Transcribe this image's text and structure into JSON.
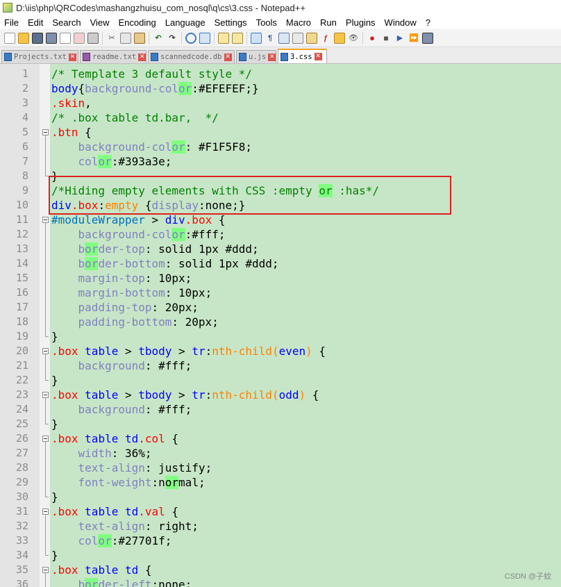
{
  "window": {
    "title": "D:\\iis\\php\\QRCodes\\mashangzhuisu_com_nosql\\q\\cs\\3.css - Notepad++"
  },
  "menu": [
    "File",
    "Edit",
    "Search",
    "View",
    "Encoding",
    "Language",
    "Settings",
    "Tools",
    "Macro",
    "Run",
    "Plugins",
    "Window",
    "?"
  ],
  "tabs": [
    {
      "label": "Projects.txt",
      "icon": "file-blue-icon",
      "active": false
    },
    {
      "label": "readme.txt",
      "icon": "file-purple-icon",
      "active": false
    },
    {
      "label": "scannedcode.db",
      "icon": "file-blue-icon",
      "active": false
    },
    {
      "label": "u.js",
      "icon": "file-blue-icon",
      "active": false
    },
    {
      "label": "3.css",
      "icon": "file-blue-icon",
      "active": true
    }
  ],
  "editor": {
    "lines": [
      {
        "n": "1",
        "tokens": [
          [
            "com",
            "/* Template 3 default style */"
          ]
        ]
      },
      {
        "n": "2",
        "tokens": [
          [
            "sel",
            "body"
          ],
          [
            "pun",
            "{"
          ],
          [
            "prop",
            "background-col"
          ],
          [
            "prop hl",
            "or"
          ],
          [
            "pun",
            ":"
          ],
          [
            "val",
            "#EFEFEF"
          ],
          [
            "pun",
            ";}"
          ]
        ]
      },
      {
        "n": "3",
        "tokens": [
          [
            "cls",
            ".skin"
          ],
          [
            "pun",
            ","
          ]
        ]
      },
      {
        "n": "4",
        "tokens": [
          [
            "com",
            "/* .box table td.bar,  */"
          ]
        ]
      },
      {
        "n": "5",
        "tokens": [
          [
            "cls",
            ".btn"
          ],
          [
            "pun",
            " {"
          ]
        ]
      },
      {
        "n": "6",
        "tokens": [
          [
            "pun",
            "    "
          ],
          [
            "prop",
            "background-col"
          ],
          [
            "prop hl",
            "or"
          ],
          [
            "pun",
            ": "
          ],
          [
            "val",
            "#F1F5F8"
          ],
          [
            "pun",
            ";"
          ]
        ]
      },
      {
        "n": "7",
        "tokens": [
          [
            "pun",
            "    "
          ],
          [
            "prop",
            "col"
          ],
          [
            "prop hl",
            "or"
          ],
          [
            "pun",
            ":"
          ],
          [
            "val",
            "#393a3e"
          ],
          [
            "pun",
            ";"
          ]
        ]
      },
      {
        "n": "8",
        "tokens": [
          [
            "pun",
            "}"
          ]
        ]
      },
      {
        "n": "9",
        "tokens": [
          [
            "com",
            "/*Hiding empty elements with CSS :empty "
          ],
          [
            "com hl",
            "or"
          ],
          [
            "com",
            " :has*/"
          ]
        ]
      },
      {
        "n": "10",
        "tokens": [
          [
            "sel",
            "div"
          ],
          [
            "cls",
            ".box"
          ],
          [
            "pun",
            ":"
          ],
          [
            "pse",
            "empty"
          ],
          [
            "pun",
            " {"
          ],
          [
            "prop",
            "display"
          ],
          [
            "pun",
            ":"
          ],
          [
            "val",
            "none"
          ],
          [
            "pun",
            ";}"
          ]
        ]
      },
      {
        "n": "11",
        "tokens": [
          [
            "id",
            "#moduleWrapper"
          ],
          [
            "pun",
            " > "
          ],
          [
            "sel",
            "div"
          ],
          [
            "cls",
            ".box"
          ],
          [
            "pun",
            " {"
          ]
        ]
      },
      {
        "n": "12",
        "tokens": [
          [
            "pun",
            "    "
          ],
          [
            "prop",
            "background-col"
          ],
          [
            "prop hl",
            "or"
          ],
          [
            "pun",
            ":"
          ],
          [
            "val",
            "#fff"
          ],
          [
            "pun",
            ";"
          ]
        ]
      },
      {
        "n": "13",
        "tokens": [
          [
            "pun",
            "    "
          ],
          [
            "prop",
            "b"
          ],
          [
            "prop hl",
            "or"
          ],
          [
            "prop",
            "der-top"
          ],
          [
            "pun",
            ": "
          ],
          [
            "val",
            "solid 1px #ddd"
          ],
          [
            "pun",
            ";"
          ]
        ]
      },
      {
        "n": "14",
        "tokens": [
          [
            "pun",
            "    "
          ],
          [
            "prop",
            "b"
          ],
          [
            "prop hl",
            "or"
          ],
          [
            "prop",
            "der-bottom"
          ],
          [
            "pun",
            ": "
          ],
          [
            "val",
            "solid 1px #ddd"
          ],
          [
            "pun",
            ";"
          ]
        ]
      },
      {
        "n": "15",
        "tokens": [
          [
            "pun",
            "    "
          ],
          [
            "prop",
            "margin-top"
          ],
          [
            "pun",
            ": "
          ],
          [
            "val",
            "10px"
          ],
          [
            "pun",
            ";"
          ]
        ]
      },
      {
        "n": "16",
        "tokens": [
          [
            "pun",
            "    "
          ],
          [
            "prop",
            "margin-bottom"
          ],
          [
            "pun",
            ": "
          ],
          [
            "val",
            "10px"
          ],
          [
            "pun",
            ";"
          ]
        ]
      },
      {
        "n": "17",
        "tokens": [
          [
            "pun",
            "    "
          ],
          [
            "prop",
            "padding-top"
          ],
          [
            "pun",
            ": "
          ],
          [
            "val",
            "20px"
          ],
          [
            "pun",
            ";"
          ]
        ]
      },
      {
        "n": "18",
        "tokens": [
          [
            "pun",
            "    "
          ],
          [
            "prop",
            "padding-bottom"
          ],
          [
            "pun",
            ": "
          ],
          [
            "val",
            "20px"
          ],
          [
            "pun",
            ";"
          ]
        ]
      },
      {
        "n": "19",
        "tokens": [
          [
            "pun",
            "}"
          ]
        ]
      },
      {
        "n": "20",
        "tokens": [
          [
            "cls",
            ".box"
          ],
          [
            "pun",
            " "
          ],
          [
            "sel",
            "table"
          ],
          [
            "pun",
            " > "
          ],
          [
            "sel",
            "tbody"
          ],
          [
            "pun",
            " > "
          ],
          [
            "sel",
            "tr"
          ],
          [
            "pun",
            ":"
          ],
          [
            "pse",
            "nth-child"
          ],
          [
            "pse",
            "("
          ],
          [
            "arg",
            "even"
          ],
          [
            "pse",
            ")"
          ],
          [
            "pun",
            " {"
          ]
        ]
      },
      {
        "n": "21",
        "tokens": [
          [
            "pun",
            "    "
          ],
          [
            "prop",
            "background"
          ],
          [
            "pun",
            ": "
          ],
          [
            "val",
            "#fff"
          ],
          [
            "pun",
            ";"
          ]
        ]
      },
      {
        "n": "22",
        "tokens": [
          [
            "pun",
            "}"
          ]
        ]
      },
      {
        "n": "23",
        "tokens": [
          [
            "cls",
            ".box"
          ],
          [
            "pun",
            " "
          ],
          [
            "sel",
            "table"
          ],
          [
            "pun",
            " > "
          ],
          [
            "sel",
            "tbody"
          ],
          [
            "pun",
            " > "
          ],
          [
            "sel",
            "tr"
          ],
          [
            "pun",
            ":"
          ],
          [
            "pse",
            "nth-child"
          ],
          [
            "pse",
            "("
          ],
          [
            "arg",
            "odd"
          ],
          [
            "pse",
            ")"
          ],
          [
            "pun",
            " {"
          ]
        ]
      },
      {
        "n": "24",
        "tokens": [
          [
            "pun",
            "    "
          ],
          [
            "prop",
            "background"
          ],
          [
            "pun",
            ": "
          ],
          [
            "val",
            "#fff"
          ],
          [
            "pun",
            ";"
          ]
        ]
      },
      {
        "n": "25",
        "tokens": [
          [
            "pun",
            "}"
          ]
        ]
      },
      {
        "n": "26",
        "tokens": [
          [
            "cls",
            ".box"
          ],
          [
            "pun",
            " "
          ],
          [
            "sel",
            "table"
          ],
          [
            "pun",
            " "
          ],
          [
            "sel",
            "td"
          ],
          [
            "cls",
            ".col"
          ],
          [
            "pun",
            " {"
          ]
        ]
      },
      {
        "n": "27",
        "tokens": [
          [
            "pun",
            "    "
          ],
          [
            "prop",
            "width"
          ],
          [
            "pun",
            ": "
          ],
          [
            "val",
            "36%"
          ],
          [
            "pun",
            ";"
          ]
        ]
      },
      {
        "n": "28",
        "tokens": [
          [
            "pun",
            "    "
          ],
          [
            "prop",
            "text-align"
          ],
          [
            "pun",
            ": "
          ],
          [
            "val",
            "justify"
          ],
          [
            "pun",
            ";"
          ]
        ]
      },
      {
        "n": "29",
        "tokens": [
          [
            "pun",
            "    "
          ],
          [
            "prop",
            "font-weight"
          ],
          [
            "pun",
            ":"
          ],
          [
            "val",
            "n"
          ],
          [
            "val hl",
            "or"
          ],
          [
            "val",
            "mal"
          ],
          [
            "pun",
            ";"
          ]
        ]
      },
      {
        "n": "30",
        "tokens": [
          [
            "pun",
            "}"
          ]
        ]
      },
      {
        "n": "31",
        "tokens": [
          [
            "cls",
            ".box"
          ],
          [
            "pun",
            " "
          ],
          [
            "sel",
            "table"
          ],
          [
            "pun",
            " "
          ],
          [
            "sel",
            "td"
          ],
          [
            "cls",
            ".val"
          ],
          [
            "pun",
            " {"
          ]
        ]
      },
      {
        "n": "32",
        "tokens": [
          [
            "pun",
            "    "
          ],
          [
            "prop",
            "text-align"
          ],
          [
            "pun",
            ": "
          ],
          [
            "val",
            "right"
          ],
          [
            "pun",
            ";"
          ]
        ]
      },
      {
        "n": "33",
        "tokens": [
          [
            "pun",
            "    "
          ],
          [
            "prop",
            "col"
          ],
          [
            "prop hl",
            "or"
          ],
          [
            "pun",
            ":"
          ],
          [
            "val",
            "#27701f"
          ],
          [
            "pun",
            ";"
          ]
        ]
      },
      {
        "n": "34",
        "tokens": [
          [
            "pun",
            "}"
          ]
        ]
      },
      {
        "n": "35",
        "tokens": [
          [
            "cls",
            ".box"
          ],
          [
            "pun",
            " "
          ],
          [
            "sel",
            "table"
          ],
          [
            "pun",
            " "
          ],
          [
            "sel",
            "td"
          ],
          [
            "pun",
            " {"
          ]
        ]
      },
      {
        "n": "36",
        "tokens": [
          [
            "pun",
            "    "
          ],
          [
            "prop",
            "b"
          ],
          [
            "prop hl",
            "or"
          ],
          [
            "prop",
            "der-left"
          ],
          [
            "pun",
            ":"
          ],
          [
            "val",
            "none"
          ],
          [
            "pun",
            ";"
          ]
        ]
      }
    ]
  },
  "watermark": "CSDN @子蚊"
}
